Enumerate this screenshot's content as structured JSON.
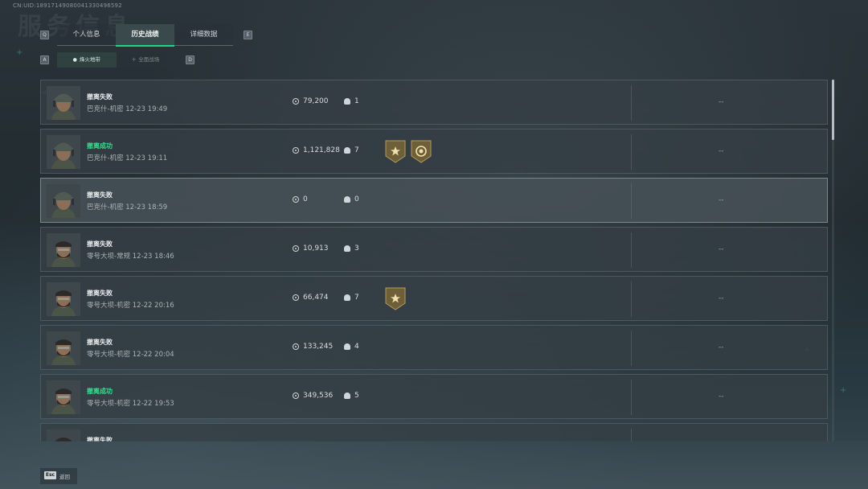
{
  "uid_text": "CN:UID:18917149080041330496592",
  "header_title": "服务信息",
  "keys": {
    "prev_tab": "Q",
    "next_tab": "E",
    "prev_sub": "A",
    "next_sub": "D"
  },
  "tabs": [
    {
      "label": "个人信息",
      "active": false
    },
    {
      "label": "历史战绩",
      "active": true
    },
    {
      "label": "详细数据",
      "active": false
    }
  ],
  "subtabs": [
    {
      "label": "烽火地带",
      "icon": "person-icon",
      "active": true
    },
    {
      "label": "全面战场",
      "icon": "crosshair-icon",
      "active": false
    }
  ],
  "records": [
    {
      "result": "撤离失败",
      "success": false,
      "detail": "巴克什-机密 12-23 19:49",
      "value": "79,200",
      "kills": "1",
      "badges": [],
      "extra": "--",
      "avatar": "helmet",
      "selected": false
    },
    {
      "result": "撤离成功",
      "success": true,
      "detail": "巴克什-机密 12-23 19:11",
      "value": "1,121,828",
      "kills": "7",
      "badges": [
        "star-badge",
        "round-badge"
      ],
      "extra": "--",
      "avatar": "helmet",
      "selected": false
    },
    {
      "result": "撤离失败",
      "success": false,
      "detail": "巴克什-机密 12-23 18:59",
      "value": "0",
      "kills": "0",
      "badges": [],
      "extra": "--",
      "avatar": "helmet",
      "selected": true
    },
    {
      "result": "撤离失败",
      "success": false,
      "detail": "零号大坝-常规 12-23 18:46",
      "value": "10,913",
      "kills": "3",
      "badges": [],
      "extra": "--",
      "avatar": "bearded",
      "selected": false
    },
    {
      "result": "撤离失败",
      "success": false,
      "detail": "零号大坝-机密 12-22 20:16",
      "value": "66,474",
      "kills": "7",
      "badges": [
        "star-badge"
      ],
      "extra": "--",
      "avatar": "bearded",
      "selected": false
    },
    {
      "result": "撤离失败",
      "success": false,
      "detail": "零号大坝-机密 12-22 20:04",
      "value": "133,245",
      "kills": "4",
      "badges": [],
      "extra": "--",
      "avatar": "bearded",
      "selected": false
    },
    {
      "result": "撤离成功",
      "success": true,
      "detail": "零号大坝-机密 12-22 19:53",
      "value": "349,536",
      "kills": "5",
      "badges": [],
      "extra": "--",
      "avatar": "bearded",
      "selected": false
    },
    {
      "result": "撤离失败",
      "success": false,
      "detail": "",
      "value": "",
      "kills": "",
      "badges": [],
      "extra": "",
      "avatar": "bearded",
      "selected": false
    }
  ],
  "footer": {
    "esc_key": "Esc",
    "back_label": "返回"
  },
  "colors": {
    "success": "#30e08d",
    "accent": "#22d48b",
    "badge_gold": "#8a7440"
  }
}
